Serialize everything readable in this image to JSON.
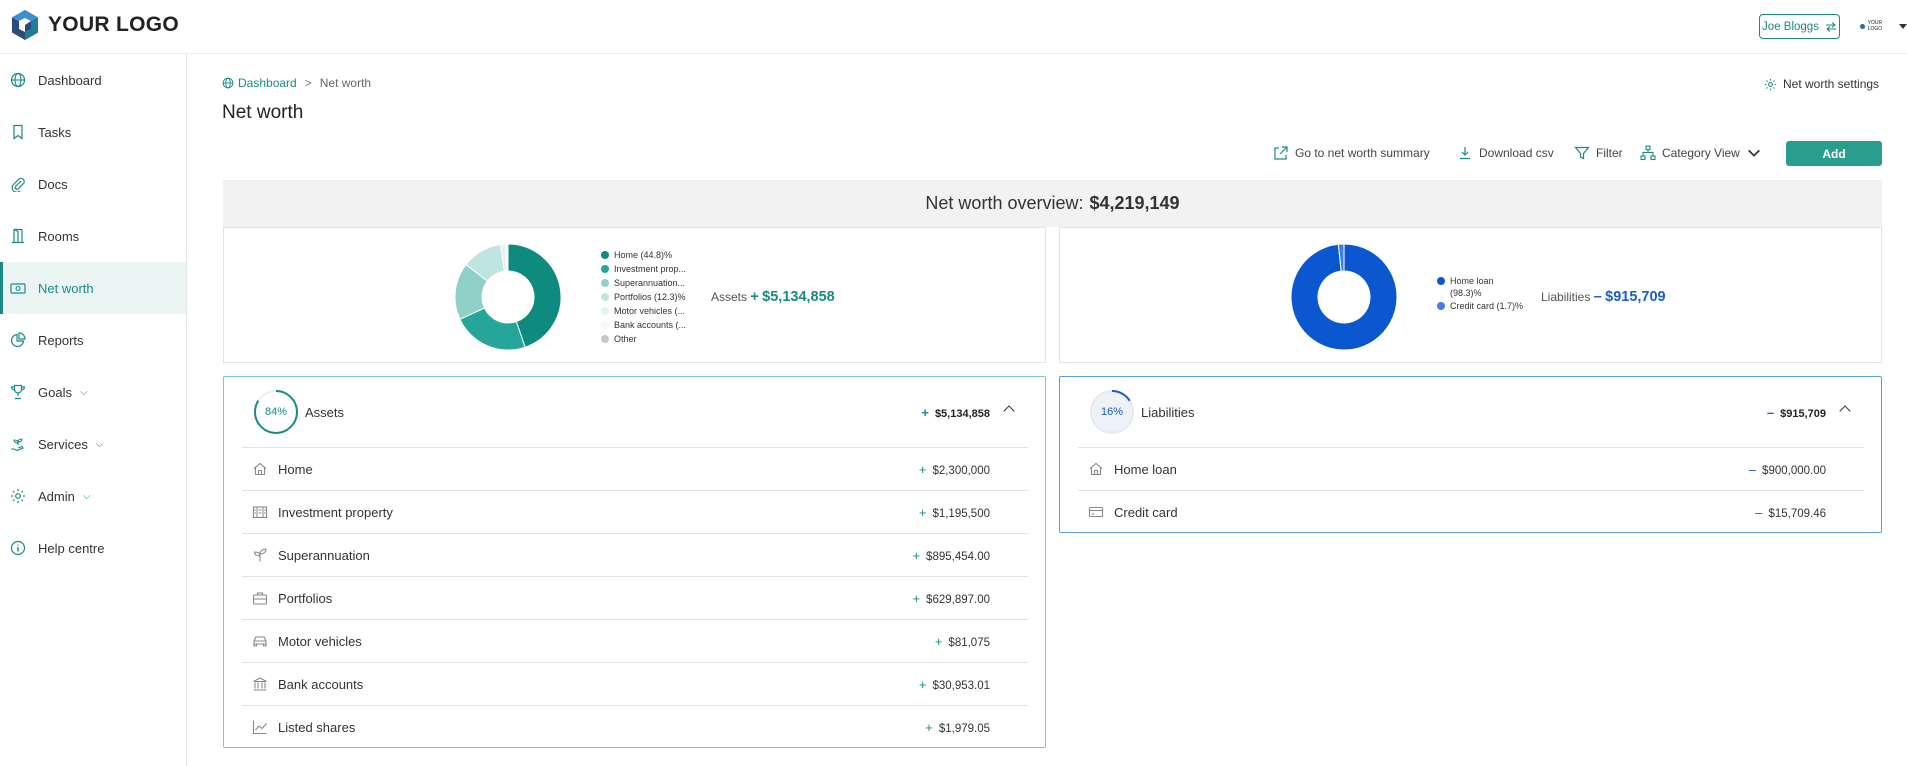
{
  "app": {
    "logo_text": "YOUR LOGO",
    "user_name": "Joe Bloggs",
    "mini_logo_text": "YOUR LOGO"
  },
  "sidebar": {
    "items": [
      {
        "label": "Dashboard",
        "icon": "globe-icon"
      },
      {
        "label": "Tasks",
        "icon": "bookmark-icon"
      },
      {
        "label": "Docs",
        "icon": "paperclip-icon"
      },
      {
        "label": "Rooms",
        "icon": "door-icon"
      },
      {
        "label": "Net worth",
        "icon": "cash-icon",
        "active": true
      },
      {
        "label": "Reports",
        "icon": "pie-chart-icon"
      },
      {
        "label": "Goals",
        "icon": "trophy-icon",
        "has_chevron": true
      },
      {
        "label": "Services",
        "icon": "hand-plant-icon",
        "has_chevron": true
      },
      {
        "label": "Admin",
        "icon": "gear-icon",
        "has_chevron": true
      },
      {
        "label": "Help centre",
        "icon": "info-icon"
      }
    ]
  },
  "breadcrumb": {
    "home": "Dashboard",
    "separator": ">",
    "current": "Net worth"
  },
  "page": {
    "title": "Net worth",
    "settings_label": "Net worth settings"
  },
  "toolbar": {
    "summary_label": "Go to net worth summary",
    "download_label": "Download csv",
    "filter_label": "Filter",
    "view_label": "Category View",
    "add_label": "Add"
  },
  "overview": {
    "label": "Net worth overview:",
    "value": "$4,219,149"
  },
  "assets_chart": {
    "legend": [
      {
        "label": "Home (44.8)%",
        "color": "#0e8a7e"
      },
      {
        "label": "Investment prop...",
        "color": "#26a69a"
      },
      {
        "label": "Superannuation...",
        "color": "#8fd1c9"
      },
      {
        "label": "Portfolios (12.3)%",
        "color": "#bfe5e0"
      },
      {
        "label": "Motor vehicles (...",
        "color": "#e3f3f1"
      },
      {
        "label": "Bank accounts (...",
        "color": "#f4faf9"
      },
      {
        "label": "Other",
        "color": "#c8c8c8"
      }
    ],
    "total_label": "Assets",
    "total_sign": "+",
    "total_value": "$5,134,858",
    "accent": "#1a8a86"
  },
  "liabilities_chart": {
    "legend": [
      {
        "label": "Home loan",
        "label2": "(98.3)%",
        "color": "#0b57d0"
      },
      {
        "label": "Credit card (1.7)%",
        "color": "#3b7fe0"
      }
    ],
    "total_label": "Liabilities",
    "total_sign": "–",
    "total_value": "$915,709",
    "accent": "#1b5fc4"
  },
  "chart_data": [
    {
      "type": "pie",
      "categories": [
        "Home",
        "Investment property",
        "Superannuation",
        "Portfolios",
        "Motor vehicles",
        "Bank accounts",
        "Other"
      ],
      "values": [
        44.8,
        23.3,
        17.4,
        12.3,
        1.6,
        0.6,
        0.04
      ]
    },
    {
      "type": "pie",
      "categories": [
        "Home loan",
        "Credit card"
      ],
      "values": [
        98.3,
        1.7
      ]
    }
  ],
  "assets": {
    "percent": "84%",
    "percent_value": 0.84,
    "title": "Assets",
    "total_sign": "+",
    "total": "$5,134,858",
    "items": [
      {
        "label": "Home",
        "icon": "house-icon",
        "amount": "$2,300,000"
      },
      {
        "label": "Investment property",
        "icon": "building-icon",
        "amount": "$1,195,500"
      },
      {
        "label": "Superannuation",
        "icon": "sprout-icon",
        "amount": "$895,454.00"
      },
      {
        "label": "Portfolios",
        "icon": "briefcase-icon",
        "amount": "$629,897.00"
      },
      {
        "label": "Motor vehicles",
        "icon": "car-icon",
        "amount": "$81,075"
      },
      {
        "label": "Bank accounts",
        "icon": "bank-icon",
        "amount": "$30,953.01"
      },
      {
        "label": "Listed shares",
        "icon": "trend-line-icon",
        "amount": "$1,979.05"
      }
    ]
  },
  "liabilities": {
    "percent": "16%",
    "percent_value": 0.16,
    "title": "Liabilities",
    "total_sign": "–",
    "total": "$915,709",
    "items": [
      {
        "label": "Home loan",
        "icon": "house-icon",
        "amount": "$900,000.00"
      },
      {
        "label": "Credit card",
        "icon": "credit-card-icon",
        "amount": "$15,709.46"
      }
    ]
  }
}
